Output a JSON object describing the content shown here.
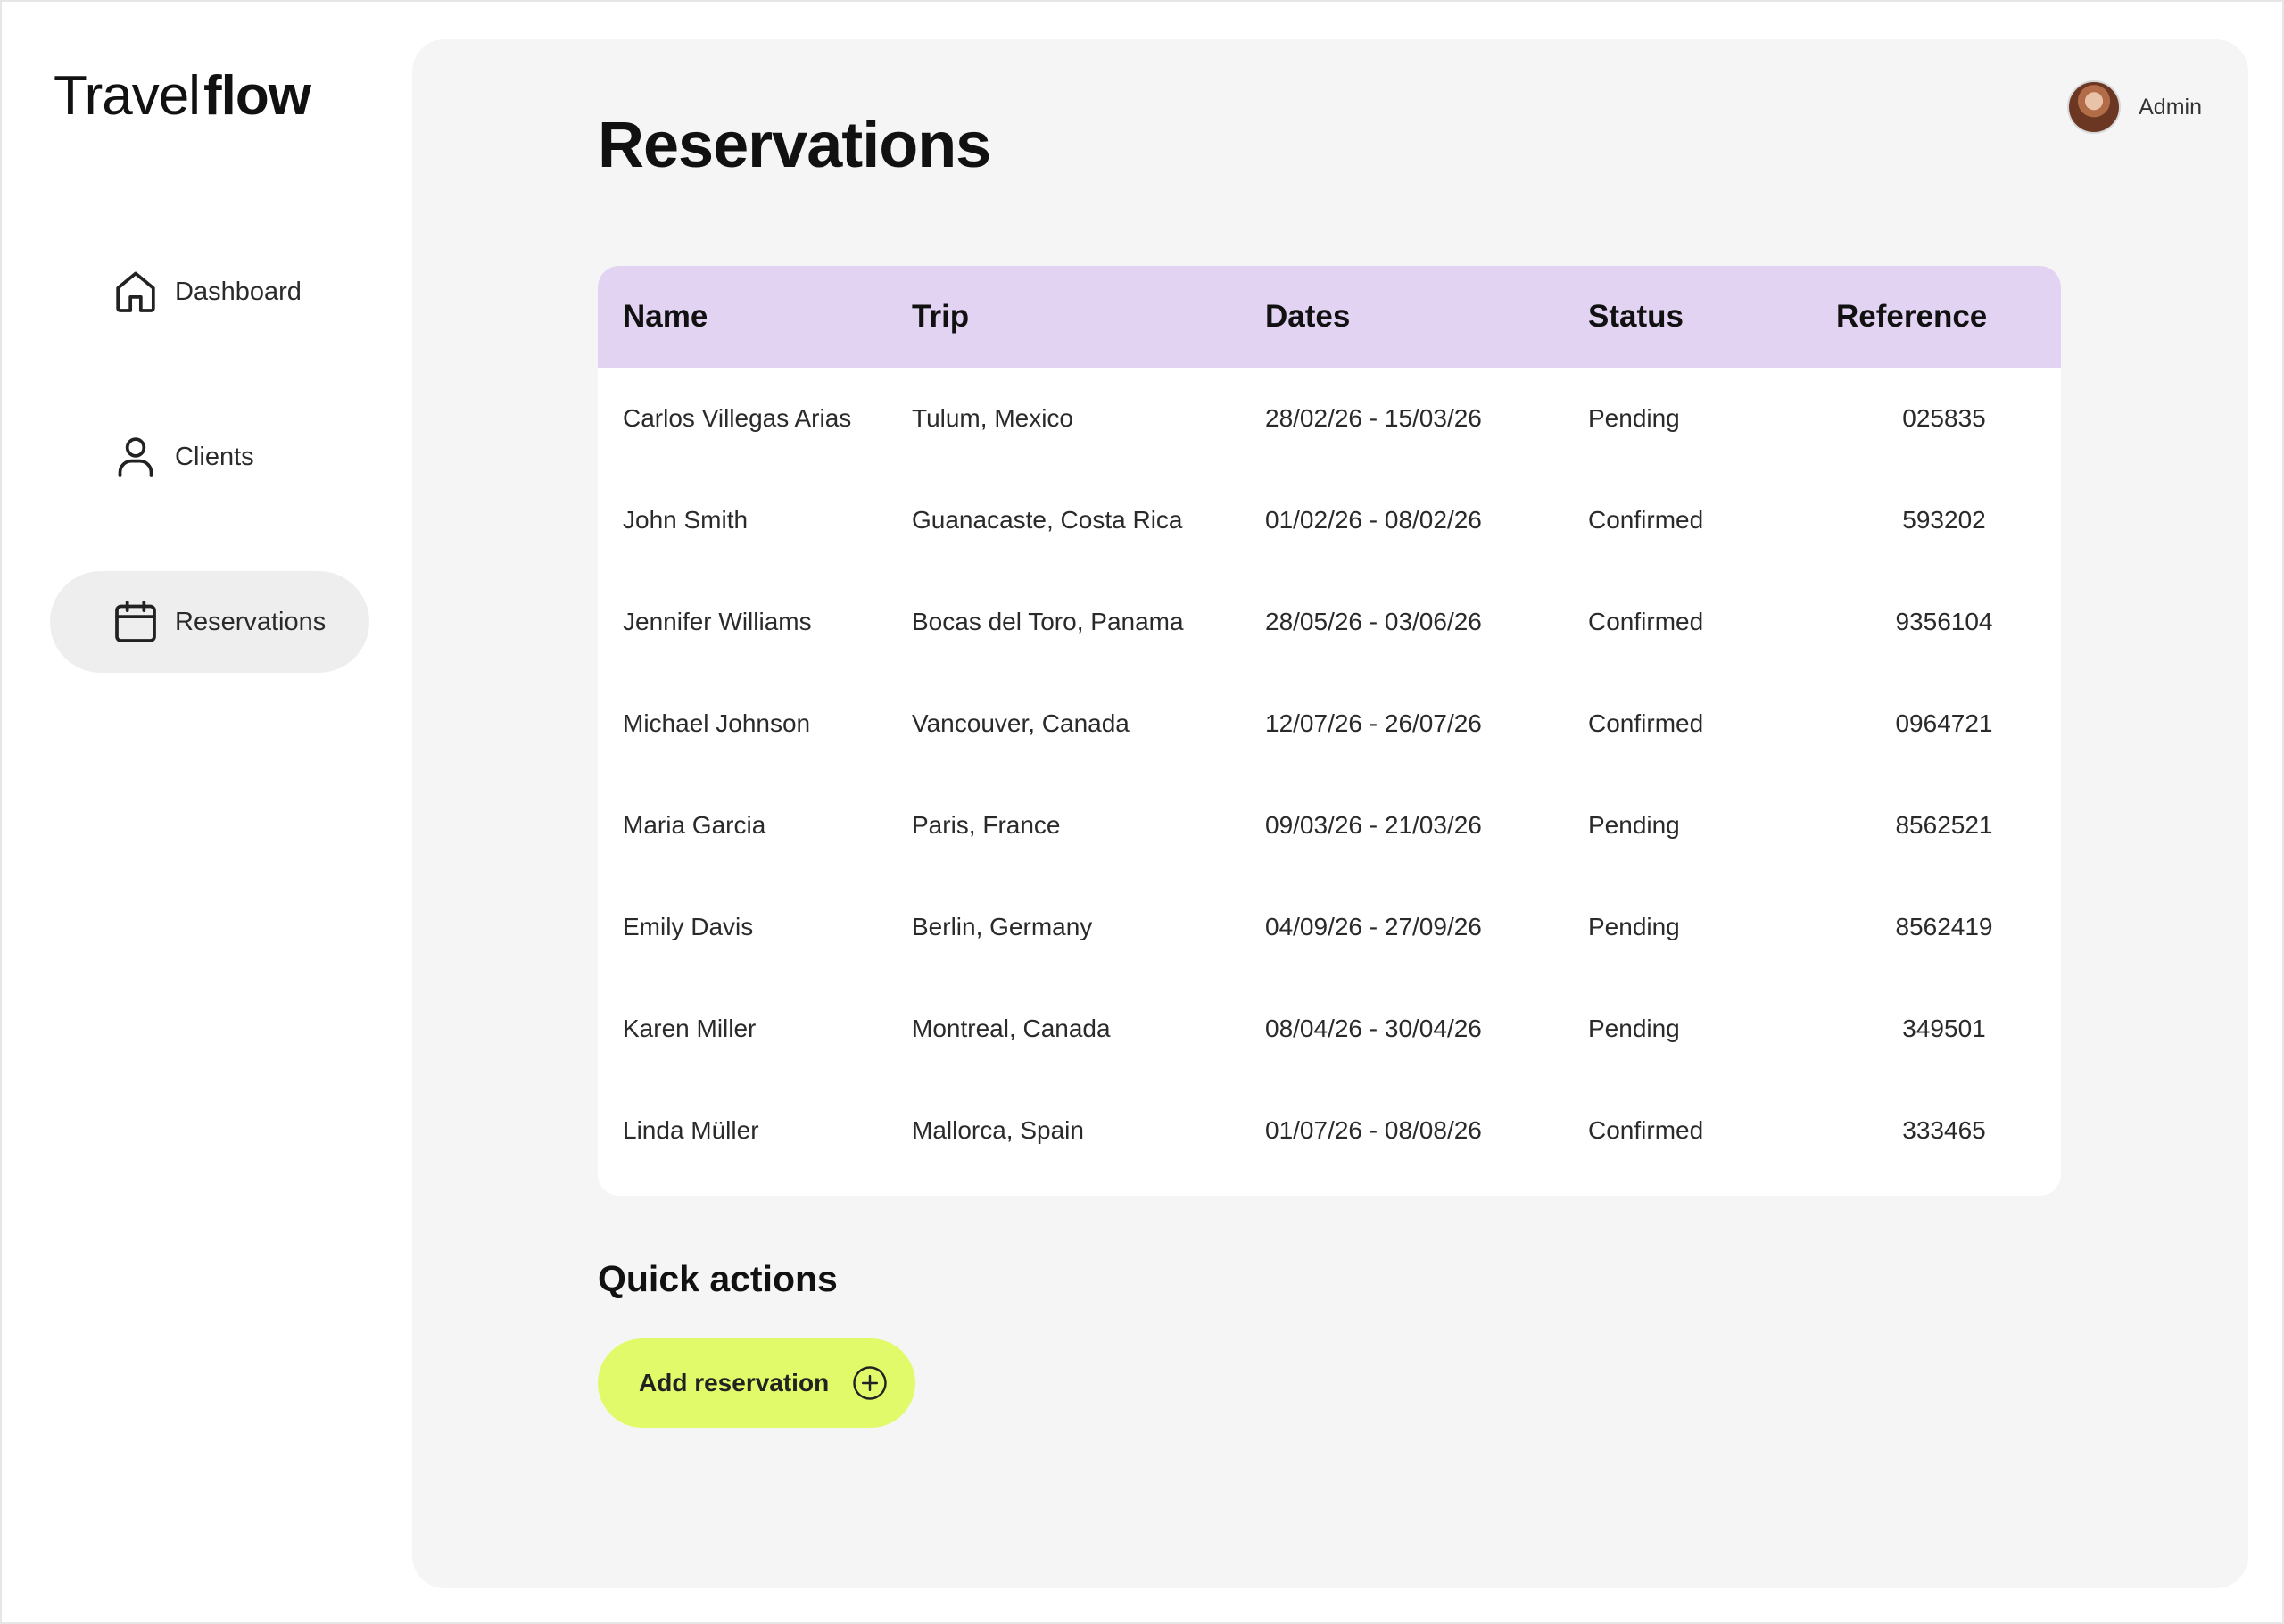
{
  "brand": {
    "light": "Travel",
    "bold": "flow"
  },
  "sidebar": {
    "items": [
      {
        "label": "Dashboard",
        "icon": "home-icon",
        "active": false
      },
      {
        "label": "Clients",
        "icon": "user-icon",
        "active": false
      },
      {
        "label": "Reservations",
        "icon": "calendar-icon",
        "active": true
      }
    ]
  },
  "header": {
    "user_name": "Admin"
  },
  "page": {
    "title": "Reservations"
  },
  "table": {
    "columns": [
      "Name",
      "Trip",
      "Dates",
      "Status",
      "Reference"
    ],
    "rows": [
      [
        "Carlos Villegas Arias",
        "Tulum, Mexico",
        "28/02/26 - 15/03/26",
        "Pending",
        "025835"
      ],
      [
        "John Smith",
        "Guanacaste, Costa Rica",
        "01/02/26 - 08/02/26",
        "Confirmed",
        "593202"
      ],
      [
        "Jennifer Williams",
        "Bocas del Toro, Panama",
        "28/05/26 - 03/06/26",
        "Confirmed",
        "9356104"
      ],
      [
        "Michael Johnson",
        "Vancouver, Canada",
        "12/07/26 - 26/07/26",
        "Confirmed",
        "0964721"
      ],
      [
        "Maria Garcia",
        "Paris, France",
        "09/03/26 - 21/03/26",
        "Pending",
        "8562521"
      ],
      [
        "Emily Davis",
        "Berlin, Germany",
        "04/09/26 - 27/09/26",
        "Pending",
        "8562419"
      ],
      [
        "Karen Miller",
        "Montreal, Canada",
        "08/04/26 - 30/04/26",
        "Pending",
        "349501"
      ],
      [
        "Linda Müller",
        "Mallorca, Spain",
        "01/07/26 - 08/08/26",
        "Confirmed",
        "333465"
      ]
    ]
  },
  "quick_actions": {
    "title": "Quick actions",
    "add_label": "Add reservation",
    "add_icon": "plus-circle-icon"
  },
  "colors": {
    "table_header": "#e2d3f3",
    "accent_button": "#e1fa6a",
    "panel_bg": "#f5f5f5",
    "active_nav_bg": "#eeeeee"
  }
}
